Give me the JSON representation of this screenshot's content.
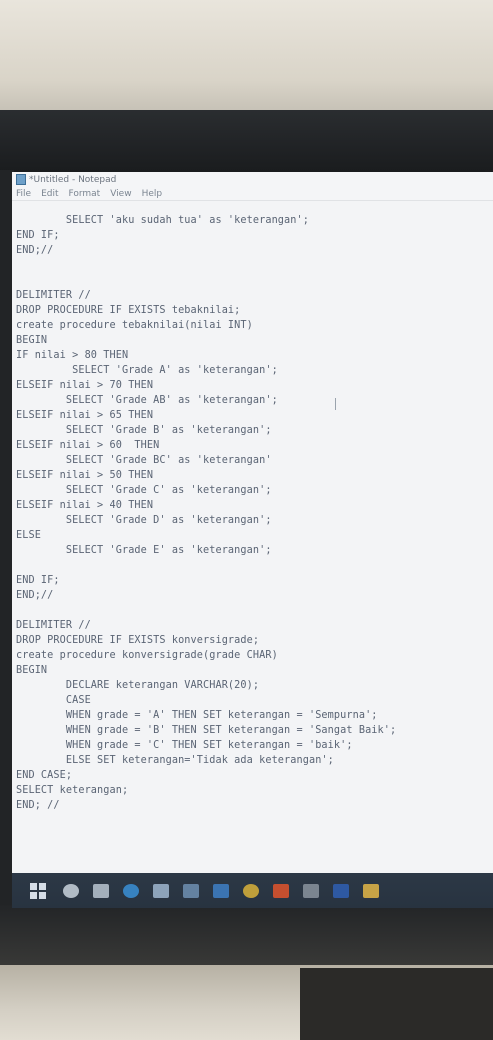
{
  "window": {
    "title": "*Untitled - Notepad",
    "menu": [
      "File",
      "Edit",
      "Format",
      "View",
      "Help"
    ]
  },
  "code": [
    "        SELECT 'aku sudah tua' as 'keterangan';",
    "END IF;",
    "END;//",
    "",
    "",
    "DELIMITER //",
    "DROP PROCEDURE IF EXISTS tebaknilai;",
    "create procedure tebaknilai(nilai INT)",
    "BEGIN",
    "IF nilai > 80 THEN",
    "         SELECT 'Grade A' as 'keterangan';",
    "ELSEIF nilai > 70 THEN",
    "        SELECT 'Grade AB' as 'keterangan';",
    "ELSEIF nilai > 65 THEN",
    "        SELECT 'Grade B' as 'keterangan';",
    "ELSEIF nilai > 60  THEN",
    "        SELECT 'Grade BC' as 'keterangan'",
    "ELSEIF nilai > 50 THEN",
    "        SELECT 'Grade C' as 'keterangan';",
    "ELSEIF nilai > 40 THEN",
    "        SELECT 'Grade D' as 'keterangan';",
    "ELSE",
    "        SELECT 'Grade E' as 'keterangan';",
    "",
    "END IF;",
    "END;//",
    "",
    "DELIMITER //",
    "DROP PROCEDURE IF EXISTS konversigrade;",
    "create procedure konversigrade(grade CHAR)",
    "BEGIN",
    "        DECLARE keterangan VARCHAR(20);",
    "        CASE",
    "        WHEN grade = 'A' THEN SET keterangan = 'Sempurna';",
    "        WHEN grade = 'B' THEN SET keterangan = 'Sangat Baik';",
    "        WHEN grade = 'C' THEN SET keterangan = 'baik';",
    "        ELSE SET keterangan='Tidak ada keterangan';",
    "END CASE;",
    "SELECT keterangan;",
    "END; //"
  ],
  "taskbar": {
    "icons": [
      "windows-start-icon",
      "search-icon",
      "task-view-icon",
      "edge-icon",
      "store-icon",
      "photos-icon",
      "mail-icon",
      "chrome-icon",
      "office-icon",
      "explorer-icon",
      "word-icon",
      "folder-icon"
    ],
    "colors": [
      "#d5dde6",
      "#c9d2dc",
      "#b9c4d0",
      "#3a8fd6",
      "#9fb6cf",
      "#6f8fb2",
      "#3e7fc6",
      "#d9b23a",
      "#e0532b",
      "#8a939d",
      "#2f5fb3",
      "#e3b646"
    ]
  }
}
